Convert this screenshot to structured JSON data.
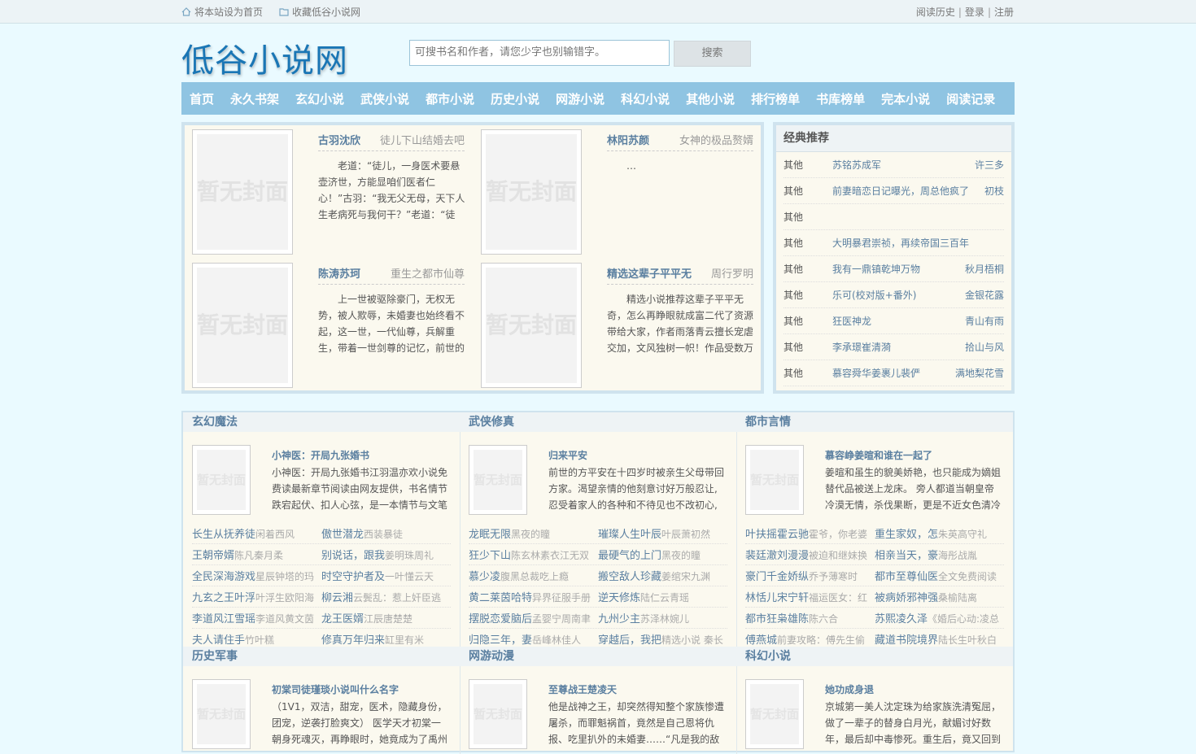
{
  "topbar": {
    "home": "将本站设为首页",
    "fav": "收藏低谷小说网",
    "history": "阅读历史",
    "login": "登录",
    "register": "注册"
  },
  "logo": "低谷小说网",
  "search": {
    "placeholder": "可搜书名和作者，请您少字也别输错字。",
    "button": "搜索"
  },
  "nav": [
    "首页",
    "永久书架",
    "玄幻小说",
    "武侠小说",
    "都市小说",
    "历史小说",
    "网游小说",
    "科幻小说",
    "其他小说",
    "排行榜单",
    "书库榜单",
    "完本小说",
    "阅读记录"
  ],
  "cover_text": "暂无封面",
  "featured": [
    {
      "name": "古羽沈欣",
      "author": "徒儿下山结婚去吧",
      "desc": "老道：“徒儿，一身医术要悬壶济世，方能显咱们医者仁心！”古羽：“我无父无母，天下人生老病死与我何干？”老道：“徒儿，"
    },
    {
      "name": "林阳苏颜",
      "author": "女神的极品赘婿",
      "desc": "…"
    },
    {
      "name": "陈涛苏珂",
      "author": "重生之都市仙尊",
      "desc": "上一世被驱除豪门，无权无势，被人欺辱，未婚妻也始终看不起，这一世，一代仙尊，兵解重生，带着一世剑尊的记忆，前世的"
    },
    {
      "name": "精选这辈子平平无",
      "author": "周行罗明",
      "desc": "精选小说推荐这辈子平平无奇，怎么再睁眼就成富二代了资源带给大家，作者雨落青云擅长宠虐交加，文风独树一帜！作品受数万"
    }
  ],
  "classic": {
    "title": "经典推荐",
    "rows": [
      {
        "c": "其他",
        "b": "苏铭苏成军",
        "a": "许三多"
      },
      {
        "c": "其他",
        "b": "前妻暗恋日记曝光，周总他疯了",
        "a": "初枝"
      },
      {
        "c": "其他",
        "b": "",
        "a": ""
      },
      {
        "c": "其他",
        "b": "大明暴君崇祯，再续帝国三百年",
        "a": ""
      },
      {
        "c": "其他",
        "b": "我有一鼎镇乾坤万物",
        "a": "秋月梧桐"
      },
      {
        "c": "其他",
        "b": "乐可(校对版+番外)",
        "a": "金银花露"
      },
      {
        "c": "其他",
        "b": "狂医神龙",
        "a": "青山有雨"
      },
      {
        "c": "其他",
        "b": "李承璟崔清漪",
        "a": "拾山与风"
      },
      {
        "c": "其他",
        "b": "慕容舜华姜裹儿裴俨",
        "a": "满地梨花雪"
      }
    ]
  },
  "cats": [
    {
      "title": "玄幻魔法",
      "top": {
        "name": "小神医：开局九张婚书",
        "desc": "小神医：开局九张婚书江羽温亦欢小说免费读最新章节阅读由网友提供，书名情节跌宕起伏、扣人心弦，是一本情节与文笔"
      },
      "list": [
        [
          "长生从抚养徒",
          "闲着西风",
          "傲世潜龙",
          "西装暴徒"
        ],
        [
          "王朝帝婿",
          "陈凡秦月柔",
          "别说话，跟我",
          "姜明珠周礼"
        ],
        [
          "全民深海游戏",
          "星辰钟塔的玛",
          "时空守护者及",
          "一叶懂云天"
        ],
        [
          "九玄之王叶浮",
          "叶浮生欧阳海",
          "柳云湘",
          "云鬓乱：惹上奸臣逃"
        ],
        [
          "李道风江雪瑶",
          "李道风黄文茵",
          "龙王医婿",
          "江辰唐楚楚"
        ],
        [
          "夫人请住手",
          "竹叶糕",
          "修真万年归来",
          "缸里有米"
        ]
      ]
    },
    {
      "title": "武侠修真",
      "top": {
        "name": "归来平安",
        "desc": "前世的方平安在十四岁时被亲生父母带回方家。渴望亲情的他刻意讨好万般忍让,忍受着家人的各种和不待见也不改初心,直到"
      },
      "list": [
        [
          "龙眠无限",
          "黑夜的瞳",
          "璀璨人生叶辰",
          "叶辰萧初然"
        ],
        [
          "狂少下山",
          "陈玄林素衣江无双",
          "最硬气的上门",
          "黑夜的瞳"
        ],
        [
          "慕少凌",
          "腹黑总裁吃上瘾",
          "搬空敌人珍藏",
          "姜绾宋九渊"
        ],
        [
          "黄二莱茵哈特",
          "异界征服手册",
          "逆天修炼",
          "陆仁云青瑶"
        ],
        [
          "摆脱恋爱脑后",
          "孟婴宁周南聿",
          "九州少主",
          "苏泽林婉儿"
        ],
        [
          "归隐三年，妻",
          "岳峰林佳人",
          "穿越后，我把",
          "精选小说 秦长"
        ]
      ]
    },
    {
      "title": "都市言情",
      "top": {
        "name": "慕容峥姜暄和谁在一起了",
        "desc": "姜暄和虽生的貌美娇艳，也只能成为嫡姐替代品被送上龙床。 旁人都道当朝皇帝冷漠无情，杀伐果断，更是不近女色清冷自"
      },
      "list": [
        [
          "叶扶摇霍云驰",
          "霍爷，你老婆",
          "重生家奴，怎",
          "朱英高守礼"
        ],
        [
          "裴廷澈刘漫漫",
          "被迫和继妹换",
          "相亲当天，豪",
          "海彤战胤"
        ],
        [
          "豪门千金娇纵",
          "乔予薄寒时",
          "都市至尊仙医",
          "全文免费阅读"
        ],
        [
          "林恬儿宋宁轩",
          "福运医女：红",
          "被病娇邪神强",
          "桑榆陆离"
        ],
        [
          "都市狂枭雄陈",
          "陈六合",
          "苏熙凌久泽",
          "《婚后心动:凌总"
        ],
        [
          "傅燕城",
          "前妻攻略：傅先生偷",
          "藏道书院境界",
          "陆长生叶秋白"
        ]
      ]
    },
    {
      "title": "历史军事",
      "top": {
        "name": "初棠司徒瑾琰小说叫什么名字",
        "desc": "（1V1，双洁，甜宠，医术，隐藏身份，团宠，逆袭打脸爽文） 医学天才初棠一朝身死魂灭，再睁眼时，她竟成为了禹州洛"
      }
    },
    {
      "title": "网游动漫",
      "top": {
        "name": "至尊战王楚凌天",
        "desc": "他是战神之王，却突然得知整个家族惨遭屠杀，而罪魁祸首，竟然是自己恩将仇报、吃里扒外的未婚妻……“凡是我的敌"
      }
    },
    {
      "title": "科幻小说",
      "top": {
        "name": "她功成身退",
        "desc": "京城第一美人沈定珠为给家族洗清冤屈，做了一辈子的替身白月光，献媚讨好数年，最后却中毒惨死。重生后，竟又回到"
      }
    }
  ]
}
